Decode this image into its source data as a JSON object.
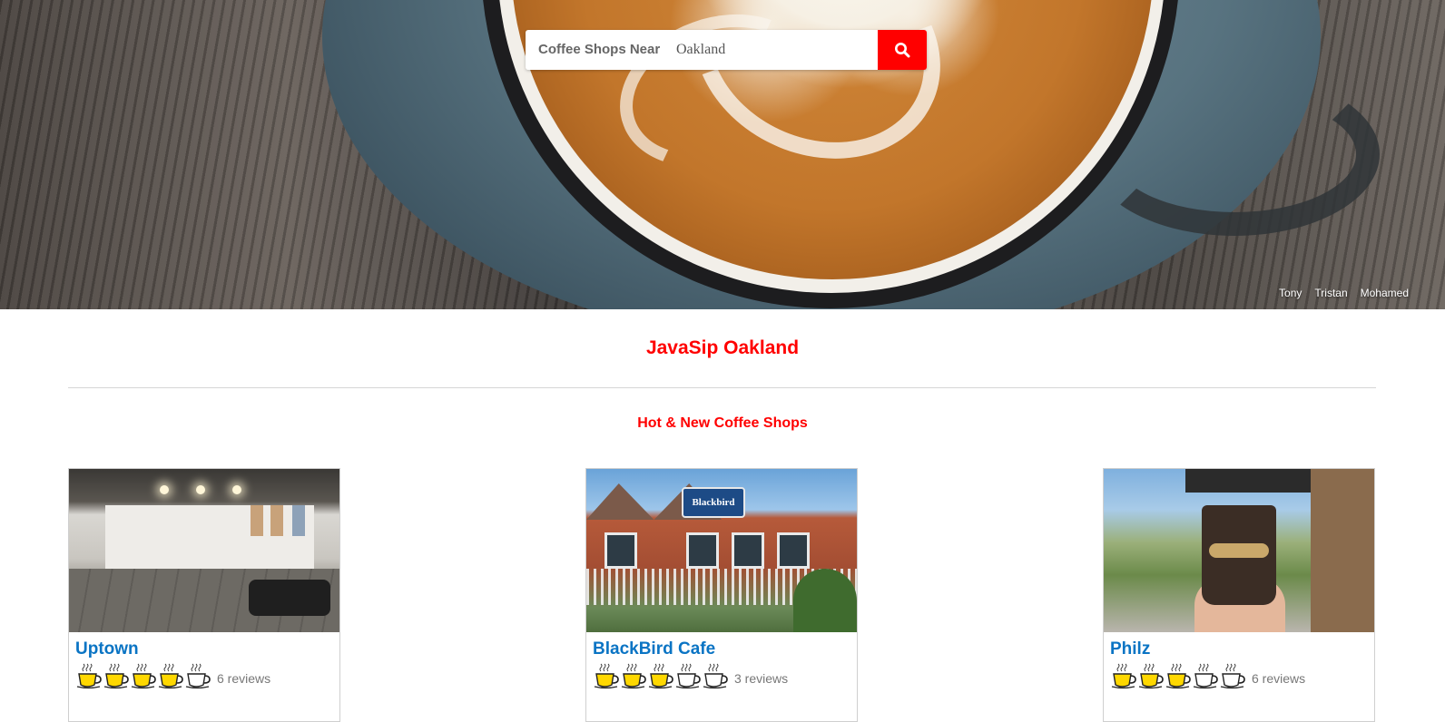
{
  "search": {
    "label": "Coffee Shops Near",
    "value": "Oakland",
    "button_icon": "search-icon"
  },
  "credits": [
    "Tony",
    "Tristan",
    "Mohamed"
  ],
  "brand_title": "JavaSip Oakland",
  "section_title": "Hot & New Coffee Shops",
  "colors": {
    "accent": "#ff0000",
    "link": "#0a74c4",
    "cup_filled": "#ffd800",
    "cup_empty": "#ffffff"
  },
  "shops": [
    {
      "name": "Uptown",
      "rating": 4,
      "max_rating": 5,
      "reviews": "6 reviews",
      "photo_icon": "cafe-interior-photo"
    },
    {
      "name": "BlackBird Cafe",
      "rating": 3,
      "max_rating": 5,
      "reviews": "3 reviews",
      "photo_icon": "cafe-storefront-photo"
    },
    {
      "name": "Philz",
      "rating": 3,
      "max_rating": 5,
      "reviews": "6 reviews",
      "photo_icon": "coffee-cup-photo"
    }
  ]
}
